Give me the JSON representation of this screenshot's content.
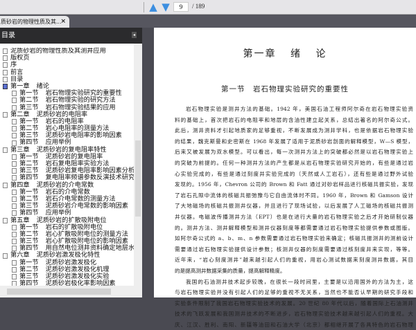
{
  "toolbar": {
    "prev_icon": "arrow-up-icon",
    "next_icon": "arrow-down-icon",
    "page_current": "9",
    "page_total": "/ 189"
  },
  "tab": {
    "title": "质砂岩的物理性质及其...",
    "close": "×"
  },
  "sidebar": {
    "title": "目录",
    "collapse": "◂"
  },
  "tree": [
    {
      "n": "",
      "t": "泥质砂岩的物理性质及其测井应用",
      "l": 0
    },
    {
      "n": "",
      "t": "版权页",
      "l": 0
    },
    {
      "n": "",
      "t": "序",
      "l": 0
    },
    {
      "n": "",
      "t": "前言",
      "l": 0
    },
    {
      "n": "",
      "t": "目录",
      "l": 0
    },
    {
      "n": "第一章",
      "t": "绪论",
      "l": 0,
      "sel": true
    },
    {
      "n": "第一节",
      "t": "岩石物理实验研究的重要性",
      "l": 1
    },
    {
      "n": "第二节",
      "t": "岩石物理实验的研究方法",
      "l": 1
    },
    {
      "n": "第三节",
      "t": "岩石物理实验结果的应用",
      "l": 1
    },
    {
      "n": "第二章",
      "t": "泥质砂岩的电阻率",
      "l": 0
    },
    {
      "n": "第一节",
      "t": "岩石的电阻率",
      "l": 1
    },
    {
      "n": "第二节",
      "t": "岩心电阻率的测量方法",
      "l": 1
    },
    {
      "n": "第三节",
      "t": "泥质砂岩电阻率的影响因素",
      "l": 1
    },
    {
      "n": "第四节",
      "t": "应用举例",
      "l": 1
    },
    {
      "n": "第三章",
      "t": "泥质砂岩的复电阻率特性",
      "l": 0
    },
    {
      "n": "第一节",
      "t": "泥质砂岩的复电阻率",
      "l": 1
    },
    {
      "n": "第二节",
      "t": "岩石复电阻率实验方法",
      "l": 1
    },
    {
      "n": "第三节",
      "t": "泥质砂岩复电阻率影响因素分析",
      "l": 1
    },
    {
      "n": "第四节",
      "t": "复电阻率频谱参数反演技术研究",
      "l": 1
    },
    {
      "n": "第四章",
      "t": "泥质砂岩的介电常数",
      "l": 0
    },
    {
      "n": "第一节",
      "t": "岩石的介电常数",
      "l": 1
    },
    {
      "n": "第二节",
      "t": "岩石介电常数的测量方法",
      "l": 1
    },
    {
      "n": "第三节",
      "t": "泥质砂岩介电常数的影响因素",
      "l": 1
    },
    {
      "n": "第四节",
      "t": "应用举例",
      "l": 1
    },
    {
      "n": "第五章",
      "t": "泥质砂岩的扩散吸附电位",
      "l": 0
    },
    {
      "n": "第一节",
      "t": "岩石的扩散吸附电位",
      "l": 1
    },
    {
      "n": "第二节",
      "t": "岩心扩散吸附电位的测量方法",
      "l": 1
    },
    {
      "n": "第三节",
      "t": "岩心扩散吸附电位的影响因素",
      "l": 1
    },
    {
      "n": "第四节",
      "t": "用自然电位测井资料确定地层水电阻率",
      "l": 1
    },
    {
      "n": "第六章",
      "t": "泥质砂岩激发极化特性",
      "l": 0
    },
    {
      "n": "第一节",
      "t": "泥质砂岩激发极化",
      "l": 1
    },
    {
      "n": "第二节",
      "t": "泥质砂岩激发极化机理",
      "l": 1
    },
    {
      "n": "第三节",
      "t": "泥质砂岩激发极化实验",
      "l": 1
    },
    {
      "n": "第四节",
      "t": "泥质砂岩极化率影响因素",
      "l": 1
    }
  ],
  "page": {
    "chapter": "第一章 绪 论",
    "section": "第一节　岩石物理实验研究的重要性",
    "lines": [
      {
        "t": "岩石物理实验是测井方法的基础。1942 年，美国石油工程师阿尔奇在岩石物理实验资",
        "ind": true
      },
      {
        "t": "料的基础上，首次把岩石的电阻率和地层的含油性建立起关系，总结出著名的阿尔奇公式。"
      },
      {
        "t": "此后，测井资料才引起地质家的足够重视，不断发展成为测井学科，也是依据岩石物理实验"
      },
      {
        "t": "的结果，魏克斯曼和史密斯在 1968 年发展了适用于泥质砂岩剖面的解释模型，W—S 模型，"
      },
      {
        "t": "后来又被发展为双水模型。可以看出，每一次测井方法上的突破都必然是以岩石物理实验上"
      },
      {
        "t": "的突破为前提的。任何一种测井方法的产生都是从岩石物理实验研究开始的，有些是通过岩"
      },
      {
        "t": "心实验完成的，有些是通过刻度井实验完成的（天然或人工岩石），还有些是通过野外试验"
      },
      {
        "t": "发现的。1956 年，Chevron 公司的 Brown 和 Fatt 通过对砂岩样品进行核磁共振实验，发现"
      },
      {
        "t": "了岩石孔隙中流体的核磁共振弛豫与它自由流体时不同。1960 年，Brown 和 Gamson 设计"
      },
      {
        "t": "了大地磁场的核磁共振测井仪器，并且进行了现场试验，以后发展了人工磁场的核磁共振测"
      },
      {
        "t": "井仪器。电磁波传播测井方法（EPT）也是在进行大量的岩石物理实验之后才开始研制仪器"
      },
      {
        "t": "的。测井方法、测井解释模型和测井仪器刻度等都需要通过岩石物理实验提供参数或图版。"
      },
      {
        "t": "如阿尔奇公式的 a、b、m、n 参数需要通过岩石物理实验来确定；核磁共振测井的测前设计"
      },
      {
        "t": "需要通过岩石物理实验提供设计参数；核测井仪器的刻度需要通过核刻度井来实现，等等。"
      },
      {
        "t": "近年来，“岩心刻度测井”越来越引起人们的重视，用岩心测试数据来刻度测井数据，其目"
      },
      {
        "t": "的是提高测井数据采集的质量，提高解释精度。",
        "last": true
      },
      {
        "t": "我国的石油测井技术起步较晚，在很长一段时间里，主要是以沿用国外的方法为主，这",
        "ind": true
      },
      {
        "t": "与岩石物理实验并没有引起人们的足够的重视不无关系，当然也不能否认早期的研究手段和"
      },
      {
        "t": "实验条件限制了我国岩石物理实验技术的发展。20 世纪 80 年代以后，随着国际上石油测井"
      },
      {
        "t": "技术的飞跃发展和我国测井技术的不断进步，岩石物理实验技术越来越引起人们的重视。大"
      },
      {
        "t": "庆、江汉、胜利、南阳、新疆等油田和石油大学（北京）都相继开展了各具特色的岩石物理"
      }
    ]
  }
}
